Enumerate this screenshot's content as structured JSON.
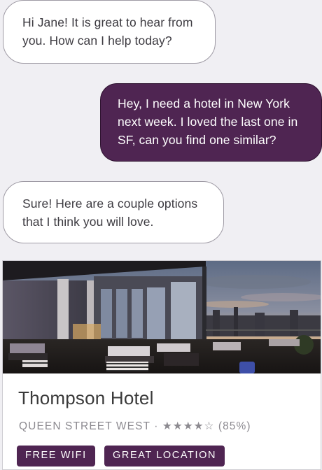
{
  "messages": [
    {
      "from": "assistant",
      "lines": [
        "Hi Jane! It is great to hear from",
        "you. How can I help today?"
      ]
    },
    {
      "from": "user",
      "lines": [
        "Hey, I need a hotel in New York",
        "next week. I loved the last one in",
        "SF, can you find one similar?"
      ]
    },
    {
      "from": "assistant",
      "lines": [
        "Sure! Here are a couple options",
        "that I think you will love."
      ]
    }
  ],
  "hotel": {
    "name": "Thompson Hotel",
    "location": "QUEEN STREET WEST",
    "separator": "·",
    "stars": "★★★★☆",
    "rating_value": 4,
    "rating_max": 5,
    "score": "(85%)",
    "tags": [
      "FREE WIFI",
      "GREAT LOCATION"
    ]
  },
  "colors": {
    "user_bubble": "#4f2552",
    "assistant_bubble": "#ffffff",
    "background": "#f0eff3",
    "tag": "#4f2552"
  }
}
